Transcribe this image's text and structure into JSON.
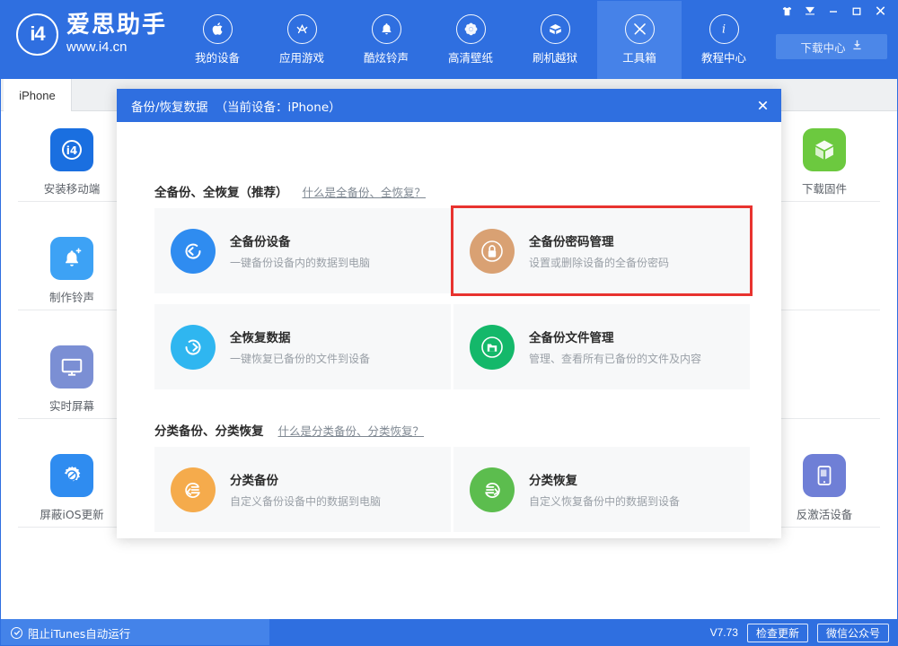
{
  "app": {
    "brand_name": "爱思助手",
    "brand_url": "www.i4.cn",
    "logo_mark": "i4",
    "accent_blue": "#2f6fe0",
    "highlight_red": "#e8332f"
  },
  "window_controls": [
    {
      "name": "skin-icon",
      "glyph": "skin"
    },
    {
      "name": "menu-icon",
      "glyph": "caret"
    },
    {
      "name": "minimize-icon",
      "glyph": "minimize"
    },
    {
      "name": "maximize-icon",
      "glyph": "maximize"
    },
    {
      "name": "close-icon",
      "glyph": "close"
    }
  ],
  "header": {
    "download_center_label": "下载中心",
    "nav": [
      {
        "label": "我的设备",
        "icon": "apple-icon",
        "active": false
      },
      {
        "label": "应用游戏",
        "icon": "appstore-icon",
        "active": false
      },
      {
        "label": "酷炫铃声",
        "icon": "bell-icon",
        "active": false
      },
      {
        "label": "高清壁纸",
        "icon": "flower-icon",
        "active": false
      },
      {
        "label": "刷机越狱",
        "icon": "openbox-icon",
        "active": false
      },
      {
        "label": "工具箱",
        "icon": "tools-icon",
        "active": true
      },
      {
        "label": "教程中心",
        "icon": "info-icon",
        "active": false
      }
    ]
  },
  "tabs": [
    {
      "label": "iPhone",
      "active": true
    }
  ],
  "background_tools": [
    {
      "label": "安装移动端",
      "icon": "i4-app-icon",
      "color": "#1a6fe0",
      "col": 0,
      "row": 0
    },
    {
      "label": "制作铃声",
      "icon": "bell-plus-icon",
      "color": "#3da2f5",
      "col": 0,
      "row": 1
    },
    {
      "label": "实时屏幕",
      "icon": "monitor-icon",
      "color": "#7b8fd4",
      "col": 0,
      "row": 2
    },
    {
      "label": "屏蔽iOS更新",
      "icon": "gear-block-icon",
      "color": "#2f8cf0",
      "col": 0,
      "row": 3
    },
    {
      "label": "下载固件",
      "icon": "cube-icon",
      "color": "#62c game",
      "col": 5,
      "row": 0
    },
    {
      "label": "反激活设备",
      "icon": "device-icon",
      "color": "#6f7fd6",
      "col": 5,
      "row": 3
    }
  ],
  "modal": {
    "title": "备份/恢复数据",
    "subtitle": "（当前设备：iPhone）",
    "close_label": "✕",
    "sections": [
      {
        "title": "全备份、全恢复（推荐）",
        "link": "什么是全备份、全恢复？",
        "cards": [
          {
            "title": "全备份设备",
            "desc": "一键备份设备内的数据到电脑",
            "icon": "backup-arrow-icon",
            "color": "#2f8cf0",
            "highlighted": false
          },
          {
            "title": "全备份密码管理",
            "desc": "设置或删除设备的全备份密码",
            "icon": "lock-icon",
            "color": "#d9a173",
            "highlighted": true
          },
          {
            "title": "全恢复数据",
            "desc": "一键恢复已备份的文件到设备",
            "icon": "restore-arrow-icon",
            "color": "#2fb6f0",
            "highlighted": false
          },
          {
            "title": "全备份文件管理",
            "desc": "管理、查看所有已备份的文件及内容",
            "icon": "folder-icon",
            "color": "#14b86a",
            "highlighted": false
          }
        ]
      },
      {
        "title": "分类备份、分类恢复",
        "link": "什么是分类备份、分类恢复？",
        "cards": [
          {
            "title": "分类备份",
            "desc": "自定义备份设备中的数据到电脑",
            "icon": "category-backup-icon",
            "color": "#f5a council",
            "highlighted": false
          },
          {
            "title": "分类恢复",
            "desc": "自定义恢复备份中的数据到设备",
            "icon": "category-restore-icon",
            "color": "#5cbd4e",
            "highlighted": false
          }
        ]
      }
    ]
  },
  "statusbar": {
    "itunes_toggle_label": "阻止iTunes自动运行",
    "version": "V7.73",
    "check_update_label": "检查更新",
    "wechat_label": "微信公众号"
  }
}
